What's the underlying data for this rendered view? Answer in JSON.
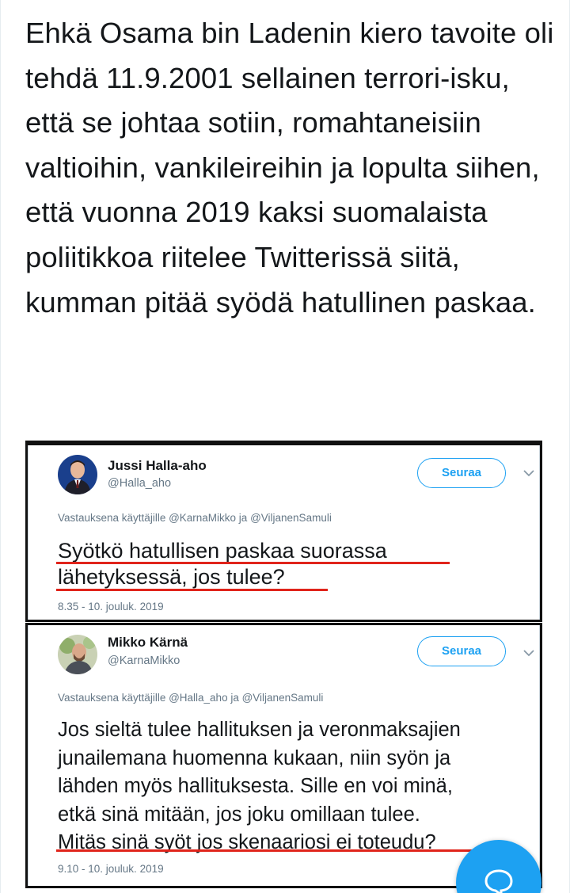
{
  "post": {
    "text": "Ehkä Osama bin Ladenin kiero tavoite oli tehdä 11.9.2001 sellainen terrori-isku, että se johtaa sotiin, romahtaneisiin valtioihin, vankileireihin ja lopulta siihen, että vuonna 2019 kaksi suomalaista poliitikkoa riitelee Twitterissä siitä, kumman pitää syödä hatullinen paskaa."
  },
  "embedded_tweets": [
    {
      "author_name": "Jussi Halla-aho",
      "handle": "@Halla_aho",
      "follow_label": "Seuraa",
      "reply_to": "Vastauksena käyttäjille @KarnaMikko ja @ViljanenSamuli",
      "text_lines": [
        "Syötkö hatullisen paskaa suorassa",
        "lähetyksessä, jos tulee?"
      ],
      "timestamp": "8.35 - 10. jouluk. 2019"
    },
    {
      "author_name": "Mikko Kärnä",
      "handle": "@KarnaMikko",
      "follow_label": "Seuraa",
      "reply_to": "Vastauksena käyttäjille @Halla_aho ja @ViljanenSamuli",
      "text_lines": [
        "Jos sieltä tulee hallituksen ja veronmaksajien",
        "junailemana huomenna kukaan, niin syön ja",
        "lähden myös hallituksesta. Sille en voi minä,",
        "etkä sinä mitään, jos joku omillaan tulee.",
        "Mitäs sinä syöt jos skenaariosi ei toteudu?"
      ],
      "timestamp": "9.10 - 10. jouluk. 2019"
    }
  ],
  "icons": {
    "chevron": "chevron-down-icon",
    "compose": "speech-bubble-icon"
  },
  "colors": {
    "accent": "#1da1f2",
    "underline": "#e0241b",
    "muted": "#657786"
  }
}
